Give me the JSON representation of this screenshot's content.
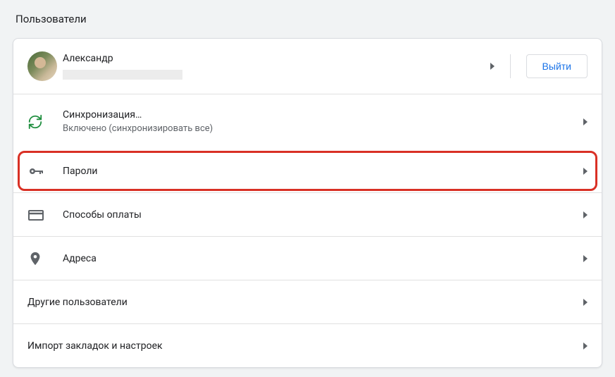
{
  "title": "Пользователи",
  "profile": {
    "name": "Александр",
    "signout_label": "Выйти"
  },
  "items": {
    "sync": {
      "title": "Синхронизация…",
      "subtitle": "Включено (синхронизировать все)"
    },
    "passwords": {
      "title": "Пароли"
    },
    "payment": {
      "title": "Способы оплаты"
    },
    "addresses": {
      "title": "Адреса"
    }
  },
  "sections": {
    "other_users": "Другие пользователи",
    "import": "Импорт закладок и настроек"
  },
  "colors": {
    "accent": "#1a73e8",
    "sync_icon": "#1e8e3e",
    "icon_grey": "#5f6368",
    "highlight": "#d93025"
  }
}
